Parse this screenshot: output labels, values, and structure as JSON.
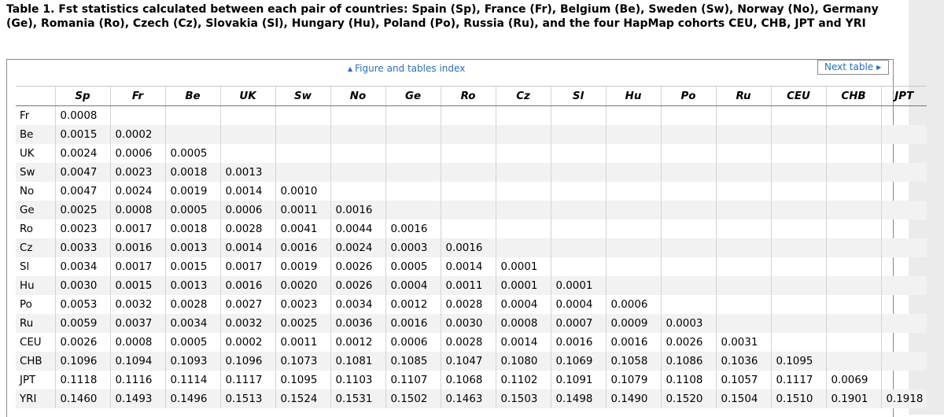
{
  "caption": "Table 1. Fst statistics calculated between each pair of countries: Spain (Sp), France (Fr), Belgium (Be), Sweden (Sw), Norway (No), Germany (Ge), Romania (Ro), Czech (Cz), Slovakia (Sl), Hungary (Hu), Poland (Po), Russia (Ru), and the four HapMap cohorts CEU, CHB, JPT and YRI",
  "nav": {
    "figure_index_label": "Figure and tables index",
    "next_table_label": "Next table"
  },
  "table": {
    "columns": [
      "Sp",
      "Fr",
      "Be",
      "UK",
      "Sw",
      "No",
      "Ge",
      "Ro",
      "Cz",
      "Sl",
      "Hu",
      "Po",
      "Ru",
      "CEU",
      "CHB",
      "JPT"
    ],
    "rows": [
      {
        "label": "Fr",
        "values": [
          "0.0008"
        ]
      },
      {
        "label": "Be",
        "values": [
          "0.0015",
          "0.0002"
        ]
      },
      {
        "label": "UK",
        "values": [
          "0.0024",
          "0.0006",
          "0.0005"
        ]
      },
      {
        "label": "Sw",
        "values": [
          "0.0047",
          "0.0023",
          "0.0018",
          "0.0013"
        ]
      },
      {
        "label": "No",
        "values": [
          "0.0047",
          "0.0024",
          "0.0019",
          "0.0014",
          "0.0010"
        ]
      },
      {
        "label": "Ge",
        "values": [
          "0.0025",
          "0.0008",
          "0.0005",
          "0.0006",
          "0.0011",
          "0.0016"
        ]
      },
      {
        "label": "Ro",
        "values": [
          "0.0023",
          "0.0017",
          "0.0018",
          "0.0028",
          "0.0041",
          "0.0044",
          "0.0016"
        ]
      },
      {
        "label": "Cz",
        "values": [
          "0.0033",
          "0.0016",
          "0.0013",
          "0.0014",
          "0.0016",
          "0.0024",
          "0.0003",
          "0.0016"
        ]
      },
      {
        "label": "Sl",
        "values": [
          "0.0034",
          "0.0017",
          "0.0015",
          "0.0017",
          "0.0019",
          "0.0026",
          "0.0005",
          "0.0014",
          "0.0001"
        ]
      },
      {
        "label": "Hu",
        "values": [
          "0.0030",
          "0.0015",
          "0.0013",
          "0.0016",
          "0.0020",
          "0.0026",
          "0.0004",
          "0.0011",
          "0.0001",
          "0.0001"
        ]
      },
      {
        "label": "Po",
        "values": [
          "0.0053",
          "0.0032",
          "0.0028",
          "0.0027",
          "0.0023",
          "0.0034",
          "0.0012",
          "0.0028",
          "0.0004",
          "0.0004",
          "0.0006"
        ]
      },
      {
        "label": "Ru",
        "values": [
          "0.0059",
          "0.0037",
          "0.0034",
          "0.0032",
          "0.0025",
          "0.0036",
          "0.0016",
          "0.0030",
          "0.0008",
          "0.0007",
          "0.0009",
          "0.0003"
        ]
      },
      {
        "label": "CEU",
        "values": [
          "0.0026",
          "0.0008",
          "0.0005",
          "0.0002",
          "0.0011",
          "0.0012",
          "0.0006",
          "0.0028",
          "0.0014",
          "0.0016",
          "0.0016",
          "0.0026",
          "0.0031"
        ]
      },
      {
        "label": "CHB",
        "values": [
          "0.1096",
          "0.1094",
          "0.1093",
          "0.1096",
          "0.1073",
          "0.1081",
          "0.1085",
          "0.1047",
          "0.1080",
          "0.1069",
          "0.1058",
          "0.1086",
          "0.1036",
          "0.1095"
        ]
      },
      {
        "label": "JPT",
        "values": [
          "0.1118",
          "0.1116",
          "0.1114",
          "0.1117",
          "0.1095",
          "0.1103",
          "0.1107",
          "0.1068",
          "0.1102",
          "0.1091",
          "0.1079",
          "0.1108",
          "0.1057",
          "0.1117",
          "0.0069"
        ]
      },
      {
        "label": "YRI",
        "values": [
          "0.1460",
          "0.1493",
          "0.1496",
          "0.1513",
          "0.1524",
          "0.1531",
          "0.1502",
          "0.1463",
          "0.1503",
          "0.1498",
          "0.1490",
          "0.1520",
          "0.1504",
          "0.1510",
          "0.1901",
          "0.1918"
        ]
      }
    ]
  }
}
